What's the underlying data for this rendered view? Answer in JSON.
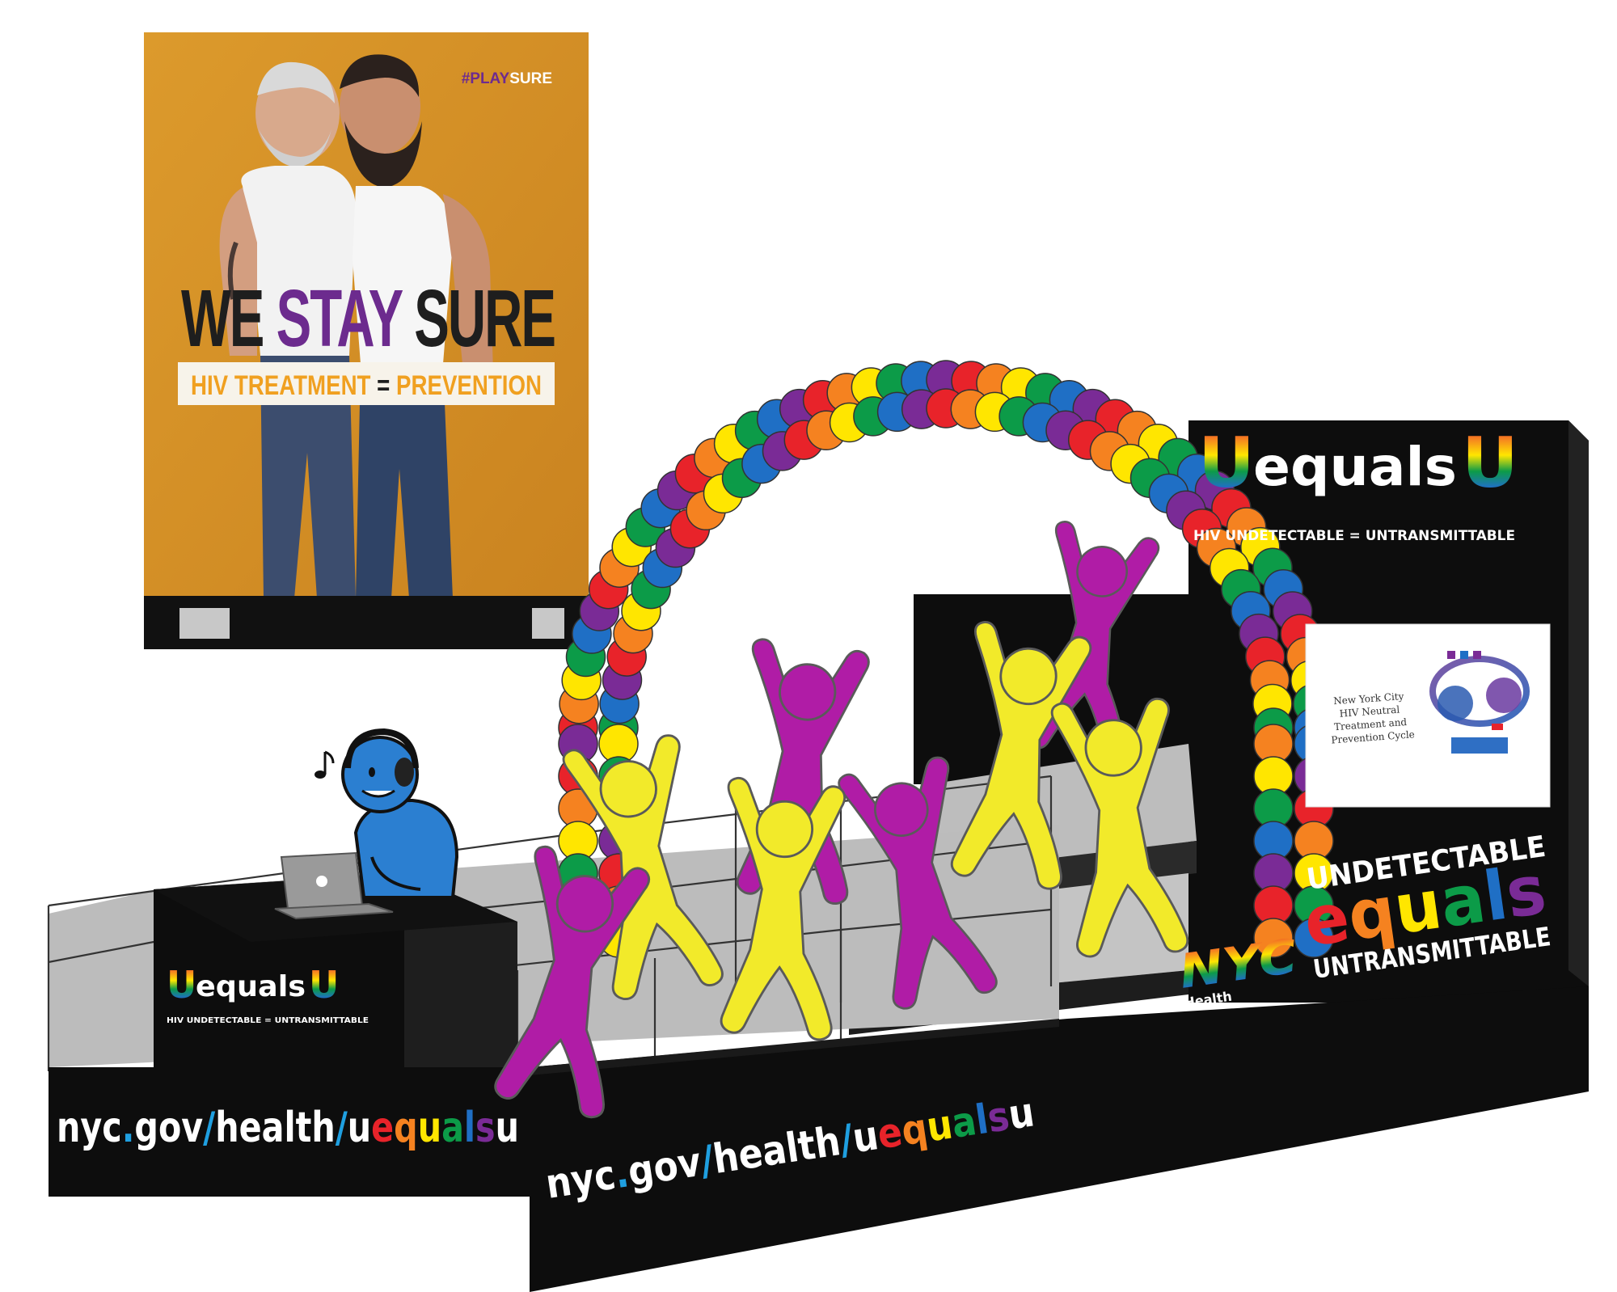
{
  "poster": {
    "hashtag_play": "#PLAY",
    "hashtag_sure": "SURE",
    "headline_we": "WE",
    "headline_stay": "STAY",
    "headline_sure": "SURE",
    "sub_treatment": "HIV TREATMENT",
    "sub_equals": "=",
    "sub_prevention": "PREVENTION"
  },
  "logo": {
    "u_left": "U",
    "equals": "equals",
    "u_right": "U",
    "tagline": "HIV UNDETECTABLE = UNTRANSMITTABLE"
  },
  "screen": {
    "line1": "New York City",
    "line2": "HIV Neutral",
    "line3": "Treatment and",
    "line4": "Prevention Cycle"
  },
  "slogan": {
    "undetectable": "UNDETECTABLE",
    "equals_letters": [
      "e",
      "q",
      "u",
      "a",
      "l",
      "s"
    ],
    "untransmittable": "UNTRANSMITTABLE"
  },
  "nyc": {
    "mark": "NYC",
    "health": "Health"
  },
  "url": {
    "nyc": "nyc",
    "dot": ".",
    "gov": "gov",
    "slash1": "/",
    "health": "health",
    "slash2": "/",
    "letters": [
      "u",
      "e",
      "q",
      "u",
      "a",
      "l",
      "s",
      "u"
    ]
  },
  "colors": {
    "rainbow": [
      "#e8232a",
      "#f58220",
      "#ffe600",
      "#0c9b48",
      "#1f6fc5",
      "#7a2b96"
    ],
    "poster_bg": "#d9952a",
    "purple_figure": "#b01ca6",
    "yellow_figure": "#f2ea2a",
    "dj_blue": "#2b7fd1"
  },
  "icons": {
    "music_note": "music-note-icon",
    "laptop": "laptop-icon",
    "apple": "apple-logo-icon"
  }
}
